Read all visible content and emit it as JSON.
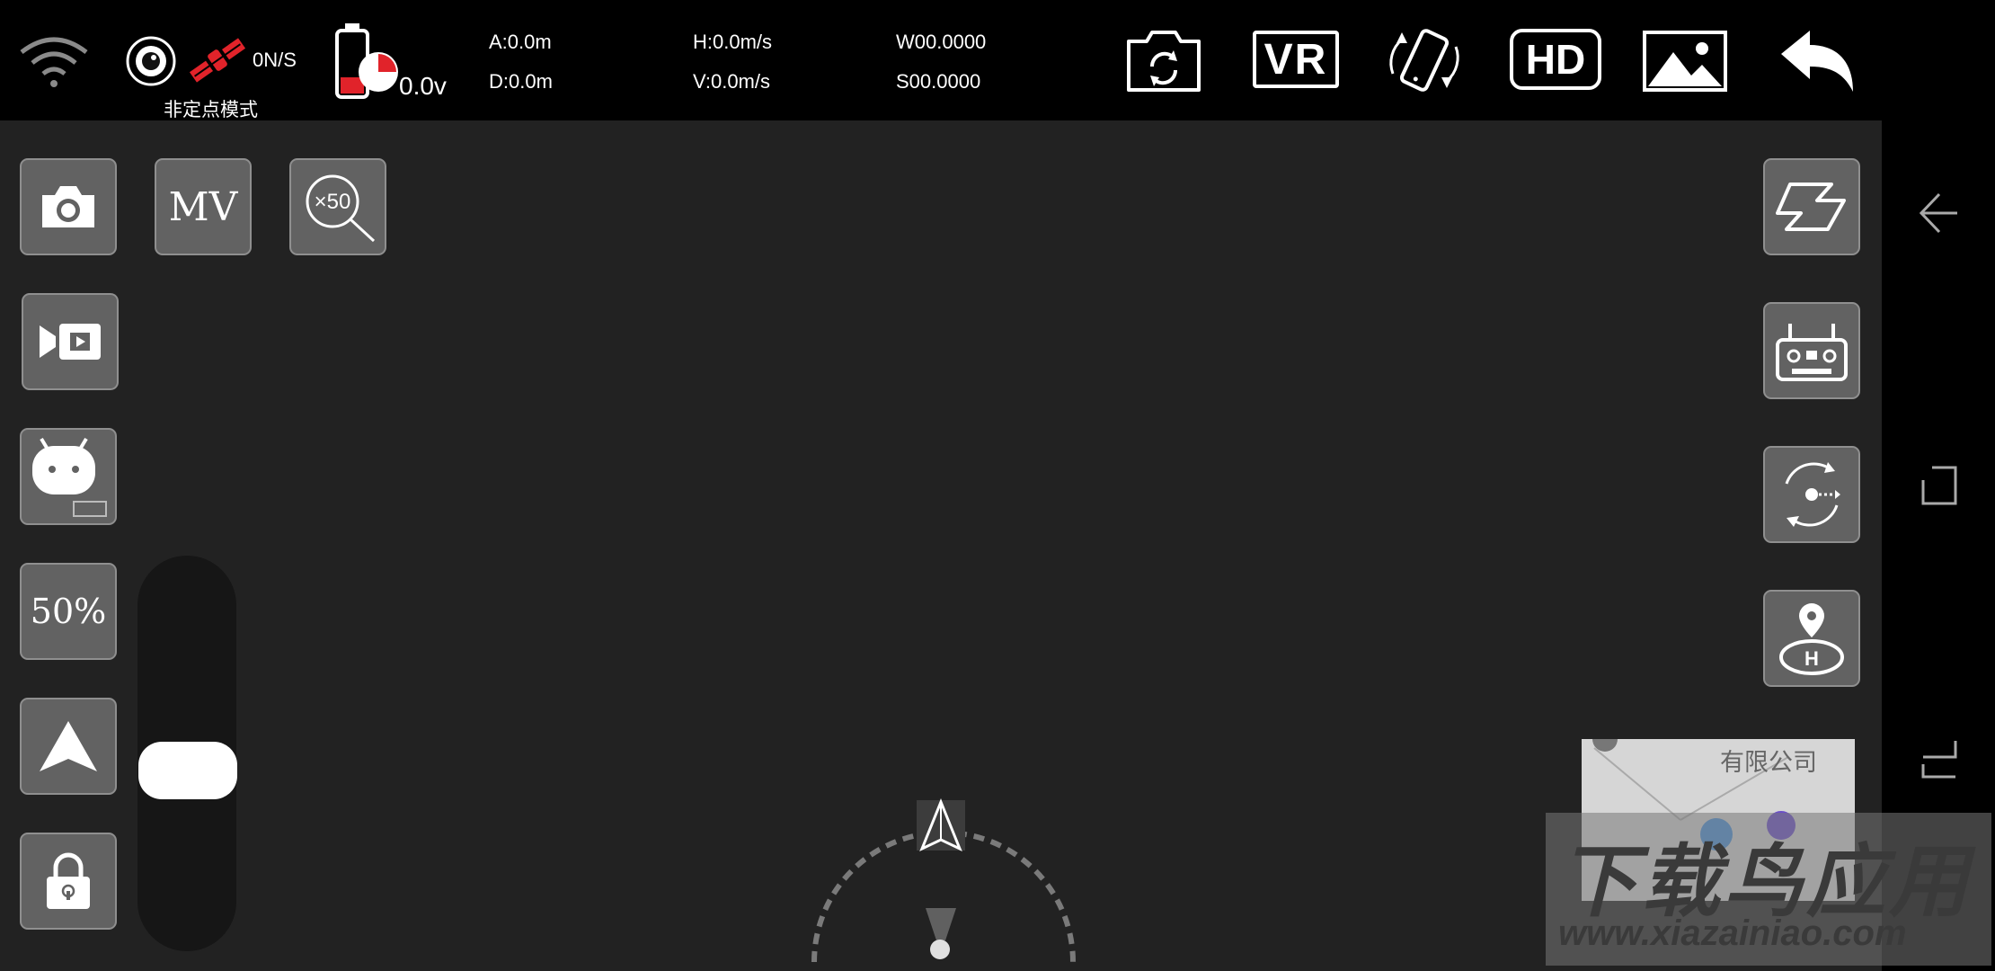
{
  "status": {
    "mode_label": "非定点模式",
    "gps_count": "0N/S",
    "voltage": "0.0v",
    "altitude": "A:0.0m",
    "distance": "D:0.0m",
    "h_speed": "H:0.0m/s",
    "v_speed": "V:0.0m/s",
    "longitude": "W00.0000",
    "latitude": "S00.0000"
  },
  "toolbar": {
    "camera_switch": "camera-switch-icon",
    "vr_label": "VR",
    "rotate": "phone-rotate-icon",
    "hd_label": "HD",
    "gallery": "gallery-icon",
    "back": "back-arrow-icon"
  },
  "left_controls": {
    "mv_label": "MV",
    "zoom_label": "×50",
    "speed_label": "50%"
  },
  "throttle": {
    "level": 0.45
  },
  "minimap": {
    "text": "有限公司"
  },
  "watermark": {
    "title": "下载鸟应用",
    "url": "www.xiazainiao.com"
  },
  "colors": {
    "accent_red": "#e1232a",
    "panel": "#626262",
    "background": "#222222"
  }
}
